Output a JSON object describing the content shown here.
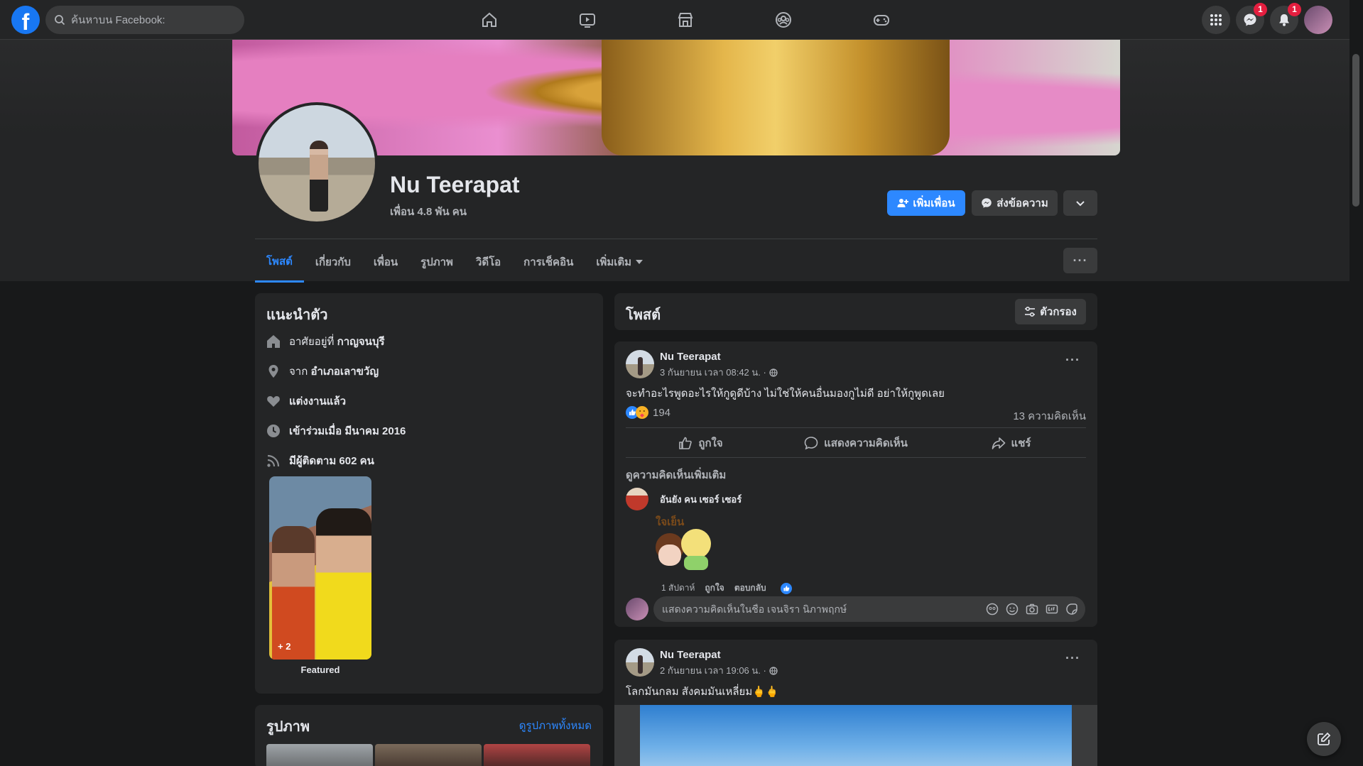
{
  "topbar": {
    "search_placeholder": "ค้นหาบน Facebook:",
    "logo_letter": "f",
    "messenger_badge": "1",
    "notifications_badge": "1",
    "nav": [
      "home",
      "watch",
      "marketplace",
      "groups",
      "gaming"
    ]
  },
  "profile": {
    "name": "Nu Teerapat",
    "friends": "เพื่อน 4.8 พัน คน",
    "add_friend": "เพิ่มเพื่อน",
    "message": "ส่งข้อความ"
  },
  "tabs": [
    "โพสต์",
    "เกี่ยวกับ",
    "เพื่อน",
    "รูปภาพ",
    "วิดีโอ",
    "การเช็คอิน",
    "เพิ่มเติม"
  ],
  "intro": {
    "title": "แนะนำตัว",
    "lives_prefix": "อาศัยอยู่ที่ ",
    "lives": "กาญจนบุรี",
    "from_prefix": "จาก ",
    "from": "อำเภอเลาขวัญ",
    "relationship": "แต่งงานแล้ว",
    "joined": "เข้าร่วมเมื่อ มีนาคม 2016",
    "followers": "มีผู้ติดตาม 602 คน",
    "featured_count": "+ 2",
    "featured_label": "Featured"
  },
  "photos": {
    "title": "รูปภาพ",
    "see_all": "ดูรูปภาพทั้งหมด"
  },
  "posts_header": {
    "title": "โพสต์",
    "filter": "ตัวกรอง"
  },
  "post1": {
    "author": "Nu Teerapat",
    "time": "3 กันยายน เวลา 08:42 น. ·",
    "text": "จะทำอะไรพูดอะไรให้กูดูดีบ้าง ไม่ใช่ให้คนอื่นมองกูไม่ดี อย่าให้กูพูดเลย",
    "reactions": "194",
    "comments": "13 ความคิดเห็น",
    "like": "ถูกใจ",
    "comment": "แสดงความคิดเห็น",
    "share": "แชร์",
    "more_comments": "ดูความคิดเห็นเพิ่มเติม",
    "commenter": "อันยัง คน เซอร์ เซอร์",
    "sticker_text": "ใจเย็น",
    "comment_time": "1 สัปดาห์",
    "comment_like": "ถูกใจ",
    "comment_reply": "ตอบกลับ",
    "comment_placeholder": "แสดงความคิดเห็นในชื่อ เจนจิรา นิภาพฤกษ์"
  },
  "post2": {
    "author": "Nu Teerapat",
    "time": "2 กันยายน เวลา 19:06 น. ·",
    "text": "โลกมันกลม สังคมมันเหลี่ยม🖕🖕"
  },
  "colors": {
    "accent": "#2d88ff",
    "background": "#18191a",
    "card": "#242526",
    "badge": "#e41e3f"
  }
}
